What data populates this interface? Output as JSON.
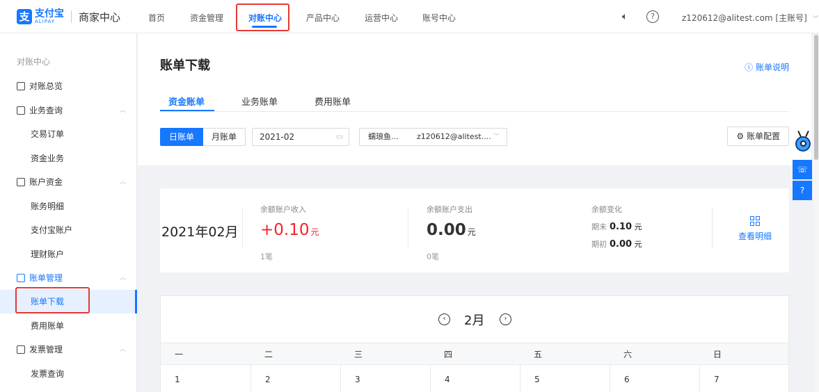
{
  "header": {
    "logo_cn": "支付宝",
    "logo_en": "ALIPAY",
    "app_title": "商家中心",
    "nav": [
      "首页",
      "资金管理",
      "对账中心",
      "产品中心",
      "运营中心",
      "账号中心"
    ],
    "active_nav": "对账中心",
    "account": "z120612@alitest.com [主账号]"
  },
  "sidebar": {
    "section_title": "对账中心",
    "items": [
      {
        "label": "对账总览"
      },
      {
        "label": "业务查询"
      },
      {
        "label": "交易订单"
      },
      {
        "label": "资金业务"
      },
      {
        "label": "账户资金"
      },
      {
        "label": "账务明细"
      },
      {
        "label": "支付宝账户"
      },
      {
        "label": "理财账户"
      },
      {
        "label": "账单管理"
      },
      {
        "label": "账单下载"
      },
      {
        "label": "费用账单"
      },
      {
        "label": "发票管理"
      },
      {
        "label": "发票查询"
      }
    ]
  },
  "main": {
    "title": "账单下载",
    "help_link": "账单说明",
    "tabs": [
      "资金账单",
      "业务账单",
      "费用账单"
    ],
    "active_tab": "资金账单",
    "period_toggle": {
      "day": "日账单",
      "month": "月账单",
      "selected": "日账单"
    },
    "date_value": "2021-02",
    "account_select": {
      "name": "蠕琅鱼...",
      "email": "z120612@alitest...."
    },
    "config_button": "账单配置"
  },
  "summary": {
    "month_label": "2021年02月",
    "income": {
      "label": "余额账户收入",
      "value": "+0.10",
      "unit": "元",
      "count": "1笔"
    },
    "expense": {
      "label": "余额账户支出",
      "value": "0.00",
      "unit": "元",
      "count": "0笔"
    },
    "change": {
      "label": "余额变化",
      "end_label": "期末",
      "end_value": "0.10",
      "end_unit": "元",
      "start_label": "期初",
      "start_value": "0.00",
      "start_unit": "元"
    },
    "detail_link": "查看明细"
  },
  "calendar": {
    "month": "2月",
    "weekdays": [
      "一",
      "二",
      "三",
      "四",
      "五",
      "六",
      "日"
    ],
    "first_week": [
      "1",
      "2",
      "3",
      "4",
      "5",
      "6",
      "7"
    ]
  },
  "colors": {
    "accent": "#1677ff",
    "positive": "#f5222d",
    "highlight": "#e53935"
  }
}
